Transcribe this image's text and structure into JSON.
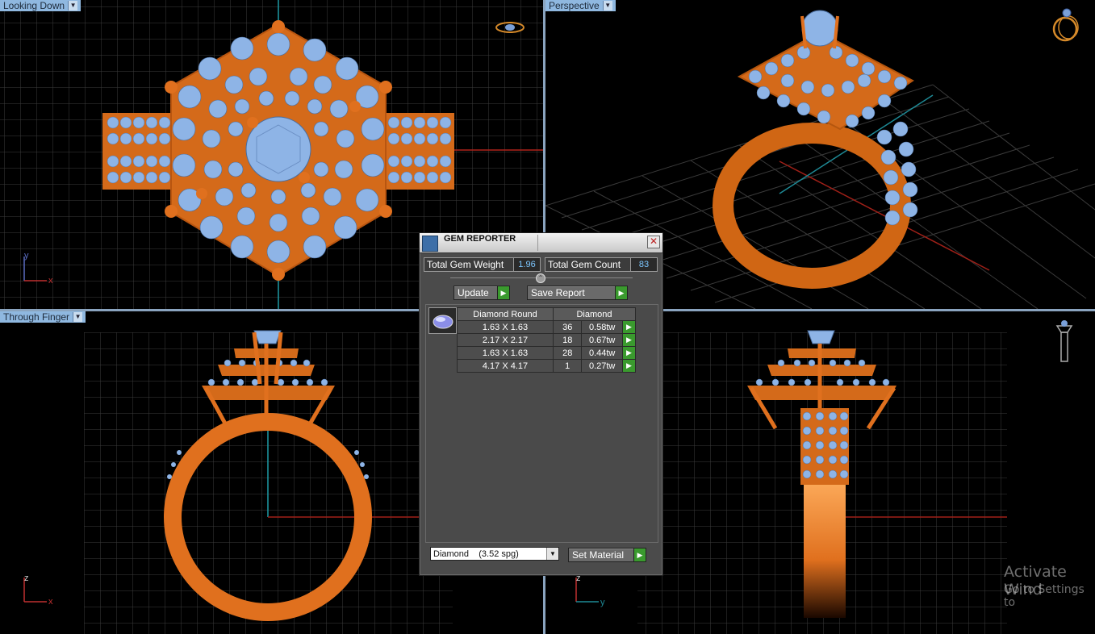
{
  "viewports": {
    "top_left": {
      "label": "Looking Down",
      "axes": {
        "h": "x",
        "v": "y"
      }
    },
    "top_right": {
      "label": "Perspective"
    },
    "bottom_left": {
      "label": "Through Finger",
      "axes": {
        "h": "x",
        "v": "z"
      }
    },
    "bottom_right": {
      "axes": {
        "h": "y",
        "v": "z"
      }
    }
  },
  "gem_reporter": {
    "title": "GEM REPORTER",
    "total_weight_label": "Total Gem Weight",
    "total_weight_value": "1.96",
    "total_count_label": "Total Gem Count",
    "total_count_value": "83",
    "update_label": "Update",
    "save_report_label": "Save Report",
    "table_headers": {
      "cut": "Diamond Round",
      "material": "Diamond"
    },
    "rows": [
      {
        "size": "1.63 X 1.63",
        "count": "36",
        "weight": "0.58tw"
      },
      {
        "size": "2.17 X 2.17",
        "count": "18",
        "weight": "0.67tw"
      },
      {
        "size": "1.63 X 1.63",
        "count": "28",
        "weight": "0.44tw"
      },
      {
        "size": "4.17 X 4.17",
        "count": "1",
        "weight": "0.27tw"
      }
    ],
    "material_select": "Diamond    (3.52 spg)",
    "set_material_label": "Set Material"
  },
  "watermark": {
    "line1": "Activate Wind",
    "line2": "Go to Settings to"
  },
  "colors": {
    "metal": "#e0701e",
    "gem": "#8eb4e6",
    "label_bg": "#8fb8e0",
    "go_button": "#3a9a2e"
  }
}
